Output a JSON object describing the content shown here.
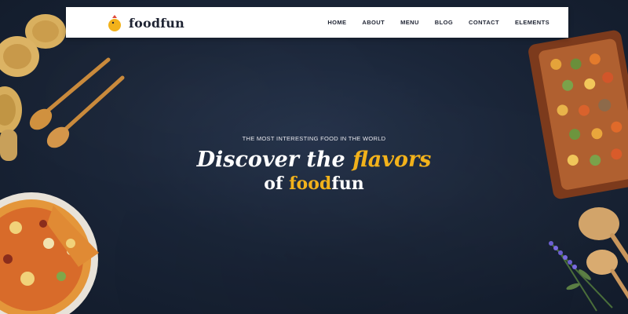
{
  "brand": {
    "name": "foodfun",
    "logo_icon": "lemon-bird-icon"
  },
  "nav": {
    "items": [
      {
        "label": "HOME"
      },
      {
        "label": "ABOUT"
      },
      {
        "label": "MENU"
      },
      {
        "label": "BLOG"
      },
      {
        "label": "CONTACT"
      },
      {
        "label": "ELEMENTS"
      }
    ]
  },
  "hero": {
    "kicker": "THE MOST INTERESTING FOOD IN THE WORLD",
    "line1_prefix": "Discover the ",
    "line1_accent": "flavors",
    "line2_prefix": "of ",
    "line2_accent": "food",
    "line2_suffix": "fun"
  },
  "colors": {
    "accent": "#f2b21b",
    "background": "#1a2538",
    "nav_text": "#1f2433",
    "hero_text": "#ffffff"
  }
}
